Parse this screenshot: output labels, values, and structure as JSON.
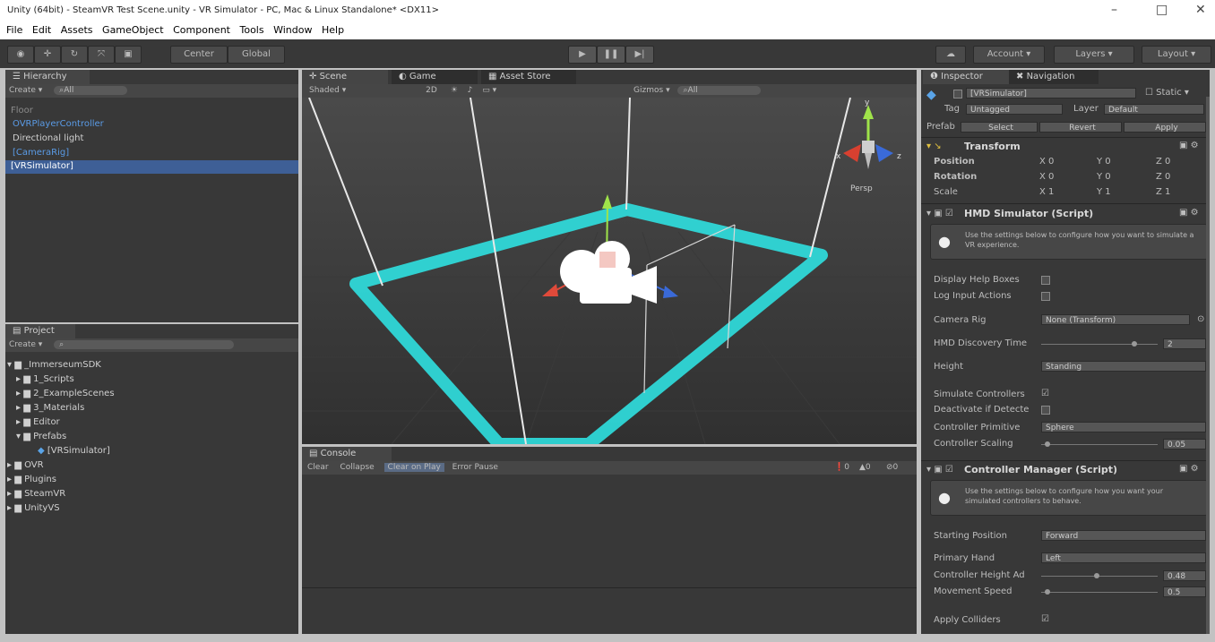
{
  "window": {
    "title": "Unity (64bit) - SteamVR Test Scene.unity - VR Simulator - PC, Mac & Linux Standalone* <DX11>",
    "minimize": "–",
    "maximize": "□",
    "close": "✕"
  },
  "menu": [
    "File",
    "Edit",
    "Assets",
    "GameObject",
    "Component",
    "Tools",
    "Window",
    "Help"
  ],
  "toolbar": {
    "center": "Center",
    "global": "Global",
    "account": "Account",
    "layers": "Layers",
    "layout": "Layout"
  },
  "hierarchy": {
    "tab": "Hierarchy",
    "create": "Create",
    "search": "All",
    "items": [
      "Floor",
      "OVRPlayerController",
      "Directional light",
      "[CameraRig]",
      "[VRSimulator]"
    ]
  },
  "project": {
    "tab": "Project",
    "create": "Create",
    "items": [
      "_ImmerseumSDK",
      "1_Scripts",
      "2_ExampleScenes",
      "3_Materials",
      "Editor",
      "Prefabs",
      "[VRSimulator]",
      "OVR",
      "Plugins",
      "SteamVR",
      "UnityVS"
    ]
  },
  "scene": {
    "tabs": [
      "Scene",
      "Game",
      "Asset Store"
    ],
    "shading": "Shaded",
    "mode2d": "2D",
    "gizmos": "Gizmos",
    "search": "All",
    "persp": "Persp",
    "axis": {
      "x": "x",
      "y": "y",
      "z": "z"
    }
  },
  "console": {
    "tab": "Console",
    "buttons": [
      "Clear",
      "Collapse",
      "Clear on Play",
      "Error Pause"
    ],
    "counts": [
      "0",
      "0",
      "0"
    ]
  },
  "inspector": {
    "tabs": [
      "Inspector",
      "Navigation"
    ],
    "object": "[VRSimulator]",
    "static": "Static",
    "tag_label": "Tag",
    "tag": "Untagged",
    "layer_label": "Layer",
    "layer": "Default",
    "prefab": "Prefab",
    "select": "Select",
    "revert": "Revert",
    "apply": "Apply",
    "transform": {
      "title": "Transform",
      "rows": [
        {
          "label": "Position",
          "x": "0",
          "y": "0",
          "z": "0"
        },
        {
          "label": "Rotation",
          "x": "0",
          "y": "0",
          "z": "0"
        },
        {
          "label": "Scale",
          "x": "1",
          "y": "1",
          "z": "1"
        }
      ]
    },
    "hmd": {
      "title": "HMD Simulator (Script)",
      "help": "Use the settings below to configure how you want to simulate a VR experience.",
      "display_help": "Display Help Boxes",
      "log_input": "Log Input Actions",
      "camera_rig": "Camera Rig",
      "camera_rig_value": "None (Transform)",
      "hmd_discovery": "HMD Discovery Time",
      "hmd_discovery_value": "2",
      "hmd_discovery_level": 0.8,
      "height": "Height",
      "height_value": "Standing",
      "simulate": "Simulate Controllers",
      "deactivate": "Deactivate if Detecte",
      "primitive": "Controller Primitive",
      "primitive_value": "Sphere",
      "scaling": "Controller Scaling",
      "scaling_value": "0.05",
      "scaling_level": 0.05
    },
    "controller": {
      "title": "Controller Manager (Script)",
      "help": "Use the settings below to configure how you want your simulated controllers to behave.",
      "starting": "Starting Position",
      "starting_value": "Forward",
      "hand": "Primary Hand",
      "hand_value": "Left",
      "height_adj": "Controller Height Ad",
      "height_adj_value": "0.48",
      "height_adj_level": 0.48,
      "speed": "Movement Speed",
      "speed_value": "0.5",
      "speed_level": 0.05,
      "colliders": "Apply Colliders"
    }
  },
  "colors": {
    "panel": "#383838",
    "selection": "#3e5f96",
    "accent_cyan": "#2fe0e0",
    "link_blue": "#5a9be6"
  }
}
